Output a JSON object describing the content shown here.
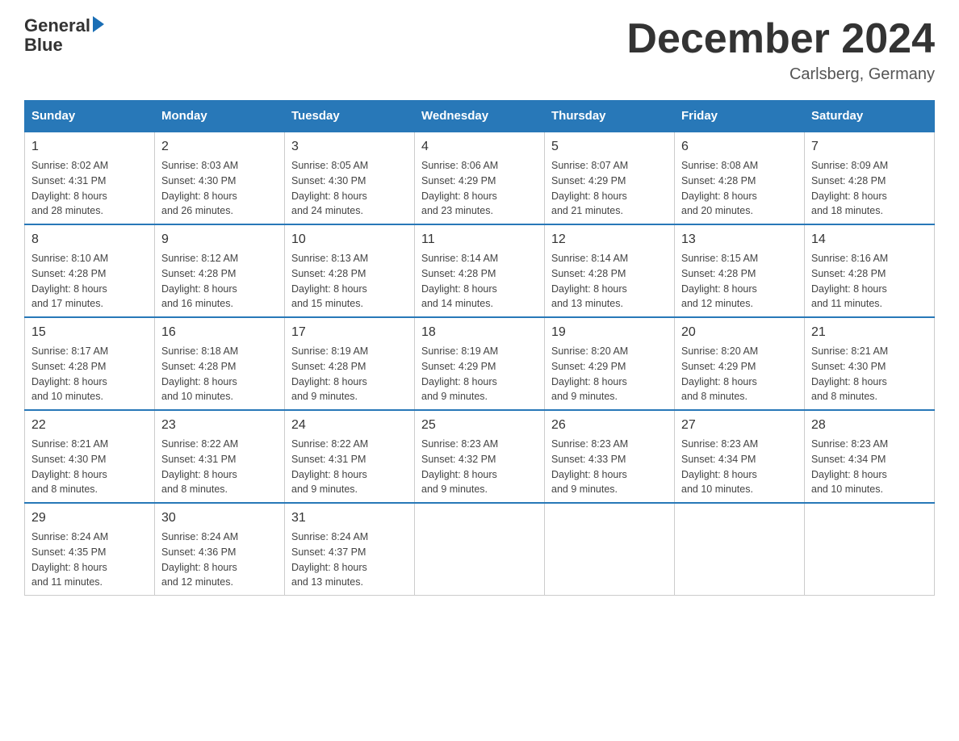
{
  "logo": {
    "text_general": "General",
    "text_blue": "Blue"
  },
  "title": "December 2024",
  "location": "Carlsberg, Germany",
  "days_header": [
    "Sunday",
    "Monday",
    "Tuesday",
    "Wednesday",
    "Thursday",
    "Friday",
    "Saturday"
  ],
  "weeks": [
    [
      {
        "day": "1",
        "info": "Sunrise: 8:02 AM\nSunset: 4:31 PM\nDaylight: 8 hours\nand 28 minutes."
      },
      {
        "day": "2",
        "info": "Sunrise: 8:03 AM\nSunset: 4:30 PM\nDaylight: 8 hours\nand 26 minutes."
      },
      {
        "day": "3",
        "info": "Sunrise: 8:05 AM\nSunset: 4:30 PM\nDaylight: 8 hours\nand 24 minutes."
      },
      {
        "day": "4",
        "info": "Sunrise: 8:06 AM\nSunset: 4:29 PM\nDaylight: 8 hours\nand 23 minutes."
      },
      {
        "day": "5",
        "info": "Sunrise: 8:07 AM\nSunset: 4:29 PM\nDaylight: 8 hours\nand 21 minutes."
      },
      {
        "day": "6",
        "info": "Sunrise: 8:08 AM\nSunset: 4:28 PM\nDaylight: 8 hours\nand 20 minutes."
      },
      {
        "day": "7",
        "info": "Sunrise: 8:09 AM\nSunset: 4:28 PM\nDaylight: 8 hours\nand 18 minutes."
      }
    ],
    [
      {
        "day": "8",
        "info": "Sunrise: 8:10 AM\nSunset: 4:28 PM\nDaylight: 8 hours\nand 17 minutes."
      },
      {
        "day": "9",
        "info": "Sunrise: 8:12 AM\nSunset: 4:28 PM\nDaylight: 8 hours\nand 16 minutes."
      },
      {
        "day": "10",
        "info": "Sunrise: 8:13 AM\nSunset: 4:28 PM\nDaylight: 8 hours\nand 15 minutes."
      },
      {
        "day": "11",
        "info": "Sunrise: 8:14 AM\nSunset: 4:28 PM\nDaylight: 8 hours\nand 14 minutes."
      },
      {
        "day": "12",
        "info": "Sunrise: 8:14 AM\nSunset: 4:28 PM\nDaylight: 8 hours\nand 13 minutes."
      },
      {
        "day": "13",
        "info": "Sunrise: 8:15 AM\nSunset: 4:28 PM\nDaylight: 8 hours\nand 12 minutes."
      },
      {
        "day": "14",
        "info": "Sunrise: 8:16 AM\nSunset: 4:28 PM\nDaylight: 8 hours\nand 11 minutes."
      }
    ],
    [
      {
        "day": "15",
        "info": "Sunrise: 8:17 AM\nSunset: 4:28 PM\nDaylight: 8 hours\nand 10 minutes."
      },
      {
        "day": "16",
        "info": "Sunrise: 8:18 AM\nSunset: 4:28 PM\nDaylight: 8 hours\nand 10 minutes."
      },
      {
        "day": "17",
        "info": "Sunrise: 8:19 AM\nSunset: 4:28 PM\nDaylight: 8 hours\nand 9 minutes."
      },
      {
        "day": "18",
        "info": "Sunrise: 8:19 AM\nSunset: 4:29 PM\nDaylight: 8 hours\nand 9 minutes."
      },
      {
        "day": "19",
        "info": "Sunrise: 8:20 AM\nSunset: 4:29 PM\nDaylight: 8 hours\nand 9 minutes."
      },
      {
        "day": "20",
        "info": "Sunrise: 8:20 AM\nSunset: 4:29 PM\nDaylight: 8 hours\nand 8 minutes."
      },
      {
        "day": "21",
        "info": "Sunrise: 8:21 AM\nSunset: 4:30 PM\nDaylight: 8 hours\nand 8 minutes."
      }
    ],
    [
      {
        "day": "22",
        "info": "Sunrise: 8:21 AM\nSunset: 4:30 PM\nDaylight: 8 hours\nand 8 minutes."
      },
      {
        "day": "23",
        "info": "Sunrise: 8:22 AM\nSunset: 4:31 PM\nDaylight: 8 hours\nand 8 minutes."
      },
      {
        "day": "24",
        "info": "Sunrise: 8:22 AM\nSunset: 4:31 PM\nDaylight: 8 hours\nand 9 minutes."
      },
      {
        "day": "25",
        "info": "Sunrise: 8:23 AM\nSunset: 4:32 PM\nDaylight: 8 hours\nand 9 minutes."
      },
      {
        "day": "26",
        "info": "Sunrise: 8:23 AM\nSunset: 4:33 PM\nDaylight: 8 hours\nand 9 minutes."
      },
      {
        "day": "27",
        "info": "Sunrise: 8:23 AM\nSunset: 4:34 PM\nDaylight: 8 hours\nand 10 minutes."
      },
      {
        "day": "28",
        "info": "Sunrise: 8:23 AM\nSunset: 4:34 PM\nDaylight: 8 hours\nand 10 minutes."
      }
    ],
    [
      {
        "day": "29",
        "info": "Sunrise: 8:24 AM\nSunset: 4:35 PM\nDaylight: 8 hours\nand 11 minutes."
      },
      {
        "day": "30",
        "info": "Sunrise: 8:24 AM\nSunset: 4:36 PM\nDaylight: 8 hours\nand 12 minutes."
      },
      {
        "day": "31",
        "info": "Sunrise: 8:24 AM\nSunset: 4:37 PM\nDaylight: 8 hours\nand 13 minutes."
      },
      {
        "day": "",
        "info": ""
      },
      {
        "day": "",
        "info": ""
      },
      {
        "day": "",
        "info": ""
      },
      {
        "day": "",
        "info": ""
      }
    ]
  ]
}
